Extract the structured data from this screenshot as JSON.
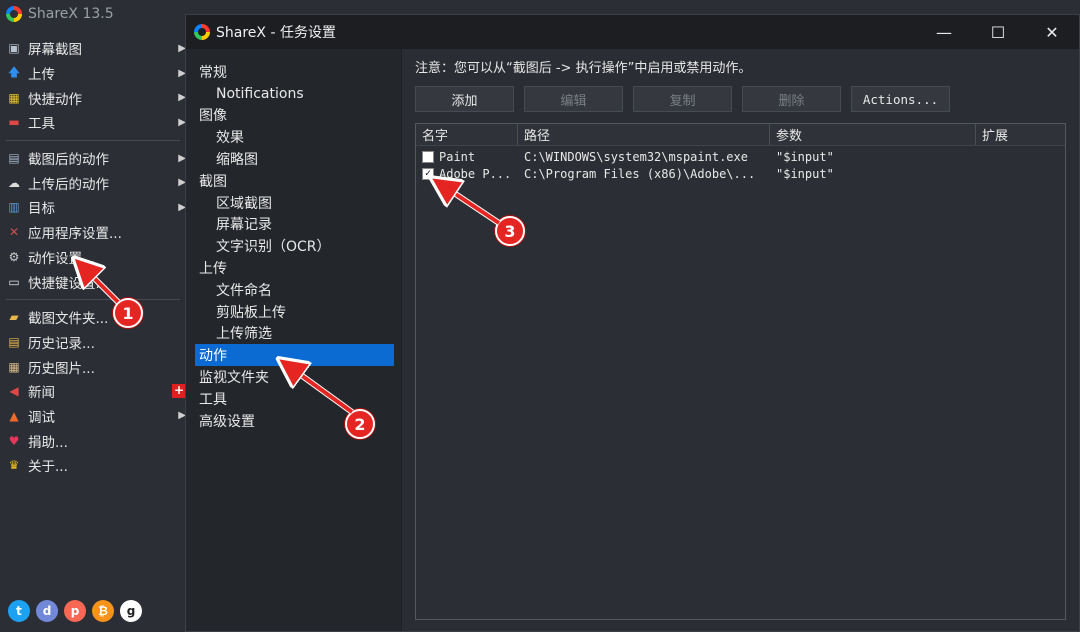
{
  "main_window": {
    "title": "ShareX 13.5",
    "menu": [
      {
        "label": "屏幕截图",
        "icon": "screenshot-icon",
        "arrow": true
      },
      {
        "label": "上传",
        "icon": "upload-arrow-icon",
        "arrow": true
      },
      {
        "label": "快捷动作",
        "icon": "grid-icon",
        "arrow": true
      },
      {
        "label": "工具",
        "icon": "toolbox-icon",
        "arrow": true
      },
      {
        "sep": true
      },
      {
        "label": "截图后的动作",
        "icon": "after-capture-icon",
        "arrow": true
      },
      {
        "label": "上传后的动作",
        "icon": "cloud-icon",
        "arrow": true
      },
      {
        "label": "目标",
        "icon": "destination-icon",
        "arrow": true
      },
      {
        "label": "应用程序设置...",
        "icon": "wrench-icon",
        "arrow": false
      },
      {
        "label": "动作设置...",
        "icon": "gear-icon",
        "arrow": false
      },
      {
        "label": "快捷键设置...",
        "icon": "keyboard-icon",
        "arrow": false
      },
      {
        "sep": true
      },
      {
        "label": "截图文件夹...",
        "icon": "folder-icon",
        "arrow": false
      },
      {
        "label": "历史记录...",
        "icon": "history-icon",
        "arrow": false
      },
      {
        "label": "历史图片...",
        "icon": "image-history-icon",
        "arrow": false
      },
      {
        "label": "新闻",
        "icon": "megaphone-icon",
        "arrow": false,
        "badge": "+"
      },
      {
        "label": "调试",
        "icon": "traffic-cone-icon",
        "arrow": true
      },
      {
        "label": "捐助...",
        "icon": "heart-icon",
        "arrow": false
      },
      {
        "label": "关于...",
        "icon": "crown-icon",
        "arrow": false
      }
    ],
    "social": [
      "twitter-icon",
      "discord-icon",
      "patreon-icon",
      "bitcoin-icon",
      "github-icon"
    ]
  },
  "task_window": {
    "title": "ShareX - 任务设置",
    "controls": {
      "minimize": "—",
      "maximize": "☐",
      "close": "✕"
    },
    "tree": [
      {
        "label": "常规",
        "child": false
      },
      {
        "label": "Notifications",
        "child": true
      },
      {
        "label": "图像",
        "child": false
      },
      {
        "label": "效果",
        "child": true
      },
      {
        "label": "缩略图",
        "child": true
      },
      {
        "label": "截图",
        "child": false
      },
      {
        "label": "区域截图",
        "child": true
      },
      {
        "label": "屏幕记录",
        "child": true
      },
      {
        "label": "文字识别（OCR）",
        "child": true
      },
      {
        "label": "上传",
        "child": false
      },
      {
        "label": "文件命名",
        "child": true
      },
      {
        "label": "剪贴板上传",
        "child": true
      },
      {
        "label": "上传筛选",
        "child": true
      },
      {
        "label": "动作",
        "child": false,
        "selected": true
      },
      {
        "label": "监视文件夹",
        "child": false
      },
      {
        "label": "工具",
        "child": false
      },
      {
        "label": "高级设置",
        "child": false
      }
    ],
    "note": "注意：您可以从“截图后 -> 执行操作”中启用或禁用动作。",
    "buttons": {
      "add": "添加",
      "edit": "编辑",
      "copy": "复制",
      "delete": "删除",
      "actions": "Actions..."
    },
    "table": {
      "headers": {
        "name": "名字",
        "path": "路径",
        "args": "参数",
        "ext": "扩展"
      },
      "rows": [
        {
          "checked": false,
          "name": "Paint",
          "path": "C:\\WINDOWS\\system32\\mspaint.exe",
          "args": "\"$input\"",
          "ext": ""
        },
        {
          "checked": true,
          "name": "Adobe P...",
          "path": "C:\\Program Files (x86)\\Adobe\\...",
          "args": "\"$input\"",
          "ext": ""
        }
      ]
    }
  },
  "annotations": {
    "callout_1": "1",
    "callout_2": "2",
    "callout_3": "3",
    "color": "#e52521"
  }
}
